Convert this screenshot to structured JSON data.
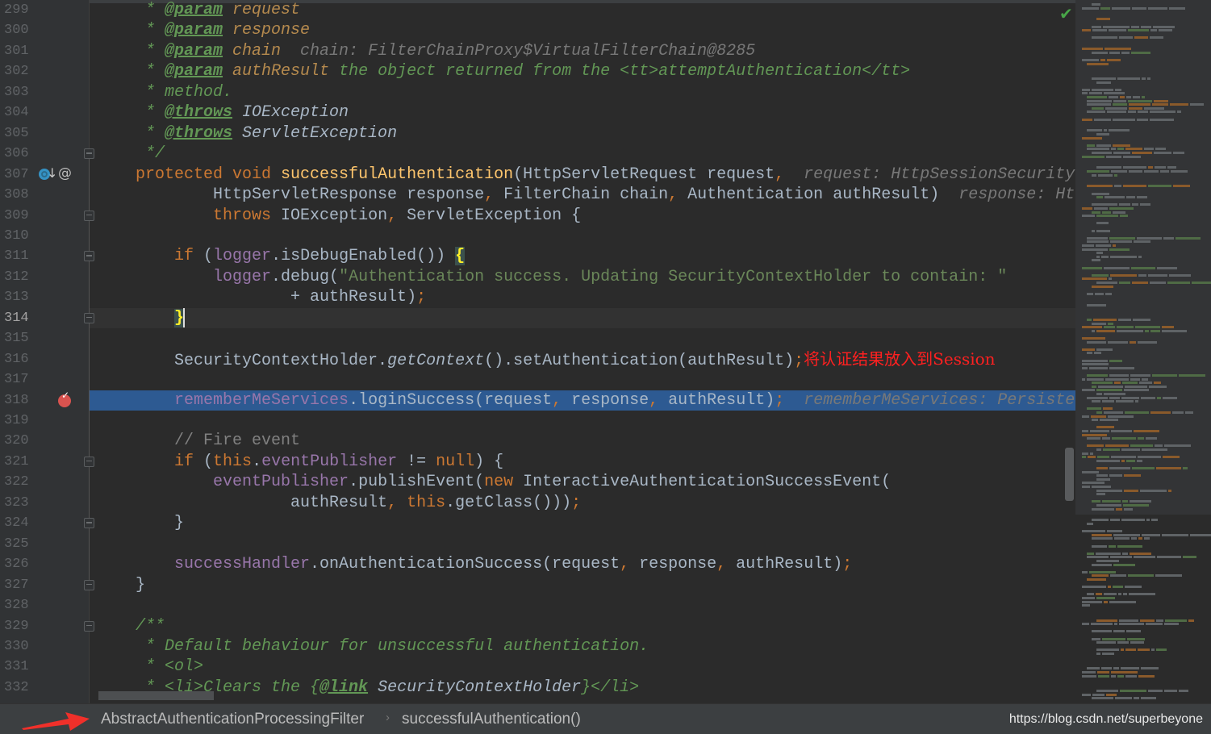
{
  "editor": {
    "first_line_number": 299,
    "current_line": 314,
    "selected_line": 318,
    "lines": [
      [
        [
          "     * ",
          "c"
        ],
        [
          "@param",
          "t"
        ],
        [
          " request",
          "dp"
        ]
      ],
      [
        [
          "     * ",
          "c"
        ],
        [
          "@param",
          "t"
        ],
        [
          " response",
          "dp"
        ]
      ],
      [
        [
          "     * ",
          "c"
        ],
        [
          "@param",
          "t"
        ],
        [
          " chain",
          "dp"
        ],
        [
          "  chain: FilterChainProxy$VirtualFilterChain@8285",
          "h"
        ]
      ],
      [
        [
          "     * ",
          "c"
        ],
        [
          "@param",
          "t"
        ],
        [
          " authResult",
          "dp"
        ],
        [
          " the object returned from the <tt>attemptAuthentication</tt>",
          "c"
        ]
      ],
      [
        [
          "     * method.",
          "c"
        ]
      ],
      [
        [
          "     * ",
          "c"
        ],
        [
          "@throws",
          "t"
        ],
        [
          " IOException",
          "dr"
        ]
      ],
      [
        [
          "     * ",
          "c"
        ],
        [
          "@throws",
          "t"
        ],
        [
          " ServletException",
          "dr"
        ]
      ],
      [
        [
          "     */",
          "c"
        ]
      ],
      [
        [
          "    protected void ",
          "k"
        ],
        [
          "successfulAuthentication",
          "f"
        ],
        [
          "(HttpServletRequest request",
          "p"
        ],
        [
          ",",
          "k"
        ],
        [
          "  request: HttpSessionSecurityContextRepository",
          "h"
        ]
      ],
      [
        [
          "            HttpServletResponse response",
          "p"
        ],
        [
          ",",
          "k"
        ],
        [
          " FilterChain chain",
          "p"
        ],
        [
          ",",
          "k"
        ],
        [
          " Authentication authResult)",
          "p"
        ],
        [
          "  response: HttpSessionSecurityContextRepository",
          "h"
        ]
      ],
      [
        [
          "            throws ",
          "k"
        ],
        [
          "IOException",
          "p"
        ],
        [
          ",",
          "k"
        ],
        [
          " ServletException {",
          "p"
        ]
      ],
      [],
      [
        [
          "        if ",
          "k"
        ],
        [
          "(",
          "p"
        ],
        [
          "logger",
          "v"
        ],
        [
          ".isDebugEnabled()) ",
          "p"
        ],
        [
          "{",
          "bm"
        ]
      ],
      [
        [
          "            ",
          "p"
        ],
        [
          "logger",
          "v"
        ],
        [
          ".debug(",
          "p"
        ],
        [
          "\"Authentication success. Updating SecurityContextHolder to contain: \"",
          "s"
        ]
      ],
      [
        [
          "                    + authResult)",
          "p"
        ],
        [
          ";",
          "k"
        ]
      ],
      [
        [
          "        ",
          "p"
        ],
        [
          "}",
          "bm"
        ]
      ],
      [],
      [
        [
          "        SecurityContextHolder.",
          "p"
        ],
        [
          "getContext",
          "it"
        ],
        [
          "().setAuthentication(authResult)",
          "p"
        ],
        [
          ";",
          "k"
        ],
        [
          "将认证结果放入到Session",
          "red"
        ]
      ],
      [],
      [
        [
          "        ",
          "p"
        ],
        [
          "rememberMeServices",
          "v"
        ],
        [
          ".loginSuccess(request",
          "p"
        ],
        [
          ",",
          "k"
        ],
        [
          " response",
          "p"
        ],
        [
          ",",
          "k"
        ],
        [
          " authResult)",
          "p"
        ],
        [
          ";",
          "k"
        ],
        [
          "  rememberMeServices: PersistentTokenBasedRememberMeServices",
          "h"
        ]
      ],
      [],
      [
        [
          "        // Fire event",
          "lc"
        ]
      ],
      [
        [
          "        if ",
          "k"
        ],
        [
          "(",
          "p"
        ],
        [
          "this",
          "k"
        ],
        [
          ".",
          "p"
        ],
        [
          "eventPublisher",
          "v"
        ],
        [
          " != ",
          "p"
        ],
        [
          "null",
          "k"
        ],
        [
          ") {",
          "p"
        ]
      ],
      [
        [
          "            ",
          "p"
        ],
        [
          "eventPublisher",
          "v"
        ],
        [
          ".publishEvent(",
          "p"
        ],
        [
          "new ",
          "k"
        ],
        [
          "InteractiveAuthenticationSuccessEvent(",
          "p"
        ]
      ],
      [
        [
          "                    authResult",
          "p"
        ],
        [
          ", ",
          "k"
        ],
        [
          "this",
          "k"
        ],
        [
          ".getClass()))",
          "p"
        ],
        [
          ";",
          "k"
        ]
      ],
      [
        [
          "        }",
          "p"
        ]
      ],
      [],
      [
        [
          "        ",
          "p"
        ],
        [
          "successHandler",
          "v"
        ],
        [
          ".onAuthenticationSuccess(request",
          "p"
        ],
        [
          ",",
          "k"
        ],
        [
          " response",
          "p"
        ],
        [
          ",",
          "k"
        ],
        [
          " authResult)",
          "p"
        ],
        [
          ";",
          "k"
        ]
      ],
      [
        [
          "    }",
          "p"
        ]
      ],
      [],
      [
        [
          "    /**",
          "c"
        ]
      ],
      [
        [
          "     * Default behaviour for unsuccessful authentication.",
          "c"
        ]
      ],
      [
        [
          "     * <ol>",
          "c"
        ]
      ],
      [
        [
          "     * <li>Clears the {",
          "c"
        ],
        [
          "@link",
          "t"
        ],
        [
          " SecurityContextHolder",
          "dr"
        ],
        [
          "}</li>",
          "c"
        ]
      ]
    ],
    "fold_lines": [
      306,
      309,
      311,
      314,
      321,
      324,
      327,
      329
    ],
    "gutter_icons": {
      "307": [
        "override-method-icon",
        "annotation-icon"
      ],
      "318": [
        "breakpoint-icon"
      ]
    },
    "annotation_symbol": "@",
    "status_check": "✔"
  },
  "colors": {
    "keyword": "#cc7832",
    "method": "#ffc66d",
    "field": "#9876aa",
    "string": "#6a8759",
    "doc_comment": "#629755",
    "selection": "#2d5a92",
    "annotation_red": "#ff2020"
  },
  "breadcrumb": {
    "items": [
      "AbstractAuthenticationProcessingFilter",
      "successfulAuthentication()"
    ],
    "separator": "›"
  },
  "watermark": "https://blog.csdn.net/superbeyone"
}
